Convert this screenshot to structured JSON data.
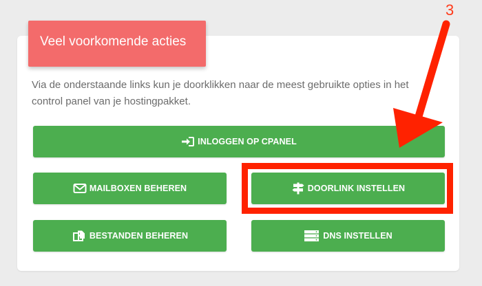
{
  "panel": {
    "title": "Veel voorkomende acties",
    "intro_line1": "Via de onderstaande links kun je doorklikken naar de meest gebruikte opties in het",
    "intro_line2": "control panel van je hostingpakket."
  },
  "buttons": {
    "cpanel": "INLOGGEN OP CPANEL",
    "mailboxes": "MAILBOXEN BEHEREN",
    "doorlink": "DOORLINK INSTELLEN",
    "files": "BESTANDEN BEHEREN",
    "dns": "DNS INSTELLEN"
  },
  "annotation": {
    "step_number": "3"
  },
  "colors": {
    "button_green": "#4cae4f",
    "title_red": "#f36b6b",
    "annotation_red": "#ff2200",
    "background": "#ececec"
  },
  "icons": {
    "cpanel": "sign-in-icon",
    "mailboxes": "envelope-icon",
    "doorlink": "signpost-icon",
    "files": "copy-files-icon",
    "dns": "server-icon"
  }
}
